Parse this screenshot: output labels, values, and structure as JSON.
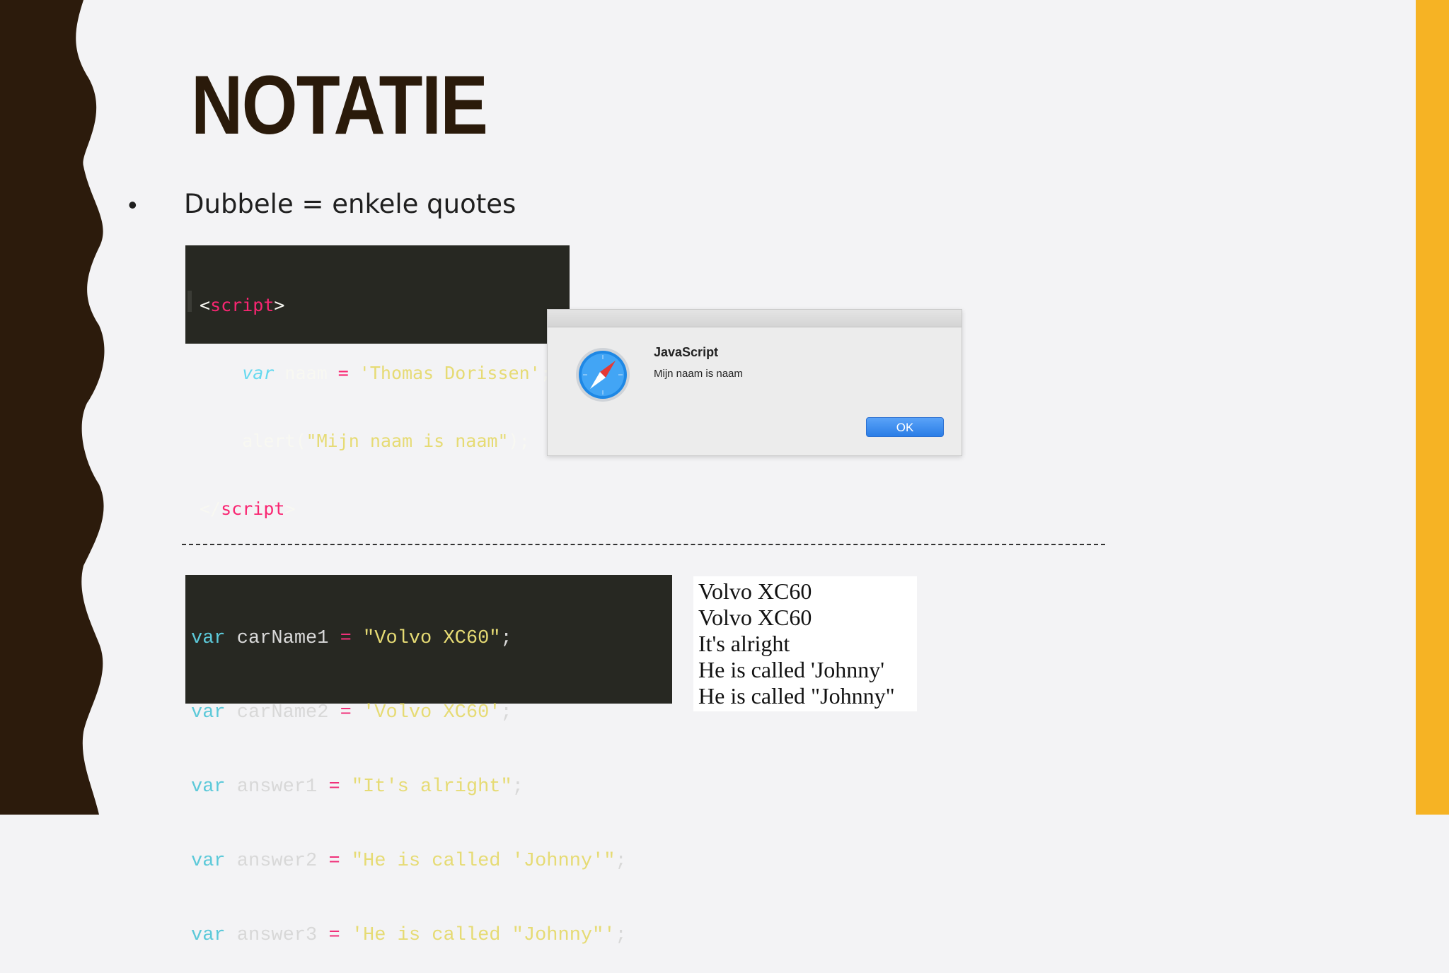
{
  "slide": {
    "title": "NOTATIE",
    "bullet": "Dubbele = enkele quotes",
    "colors": {
      "border": "#2c1b0c",
      "accent": "#f6b324",
      "background": "#f3f3f5"
    }
  },
  "code_top": {
    "open_lt": "<",
    "open_tag": "script",
    "open_gt": ">",
    "line2_kw": "var",
    "line2_name": " naam ",
    "line2_op": "=",
    "line2_str": " 'Thomas Dorissen'",
    "line2_end": ";",
    "line3_fn": "alert(",
    "line3_str": "\"Mijn naam is naam\"",
    "line3_end": ");",
    "close_lt": "</",
    "close_tag": "script",
    "close_gt": ">"
  },
  "alert": {
    "title": "JavaScript",
    "message": "Mijn naam is naam",
    "ok_label": "OK",
    "icon": "compass-icon"
  },
  "code_bottom": {
    "lines": [
      {
        "kw": "var",
        "name": " carName1 ",
        "op": "=",
        "str": " \"Volvo XC60\"",
        "end": ";"
      },
      {
        "kw": "var",
        "name": " carName2 ",
        "op": "=",
        "str": " 'Volvo XC60'",
        "end": ";"
      },
      {
        "kw": "var",
        "name": " answer1 ",
        "op": "=",
        "str": " \"It's alright\"",
        "end": ";"
      },
      {
        "kw": "var",
        "name": " answer2 ",
        "op": "=",
        "str": " \"He is called 'Johnny'\"",
        "end": ";"
      },
      {
        "kw": "var",
        "name": " answer3 ",
        "op": "=",
        "str": " 'He is called \"Johnny\"'",
        "end": ";"
      }
    ]
  },
  "output": {
    "lines": [
      "Volvo XC60",
      "Volvo XC60",
      "It's alright",
      "He is called 'Johnny'",
      "He is called \"Johnny\""
    ]
  }
}
